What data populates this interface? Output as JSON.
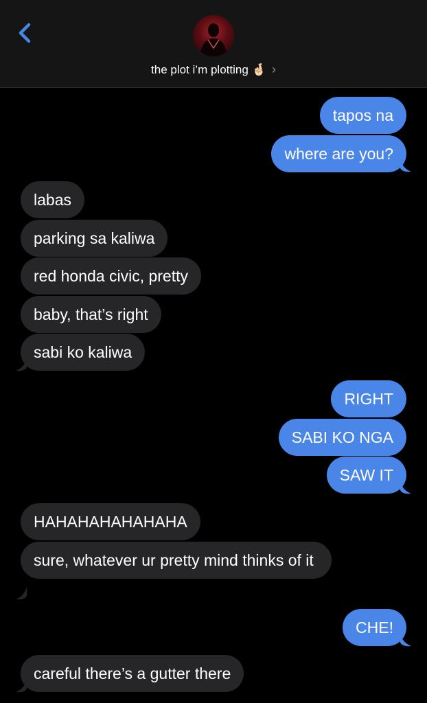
{
  "header": {
    "contact_name": "the plot i’m plotting",
    "contact_emoji": "🤞🏻",
    "chevron": "›",
    "back_icon": "chevron-left-icon",
    "accent_color": "#4a86e8"
  },
  "colors": {
    "sent_bubble": "#4a86e8",
    "received_bubble": "#262628",
    "background": "#000000"
  },
  "messages": [
    {
      "from": "me",
      "text": "tapos na"
    },
    {
      "from": "me",
      "text": "where are you?"
    },
    {
      "from": "them",
      "text": "labas"
    },
    {
      "from": "them",
      "text": "parking sa kaliwa"
    },
    {
      "from": "them",
      "text": "red honda civic, pretty"
    },
    {
      "from": "them",
      "text": "baby, that’s right"
    },
    {
      "from": "them",
      "text": "sabi ko kaliwa"
    },
    {
      "from": "me",
      "text": "RIGHT"
    },
    {
      "from": "me",
      "text": "SABI KO NGA"
    },
    {
      "from": "me",
      "text": "SAW IT"
    },
    {
      "from": "them",
      "text": "HAHAHAHAHAHAHA"
    },
    {
      "from": "them",
      "text": "sure, whatever ur pretty mind thinks of it"
    },
    {
      "from": "me",
      "text": "CHE!"
    },
    {
      "from": "them",
      "text": "careful there’s a gutter there"
    }
  ]
}
